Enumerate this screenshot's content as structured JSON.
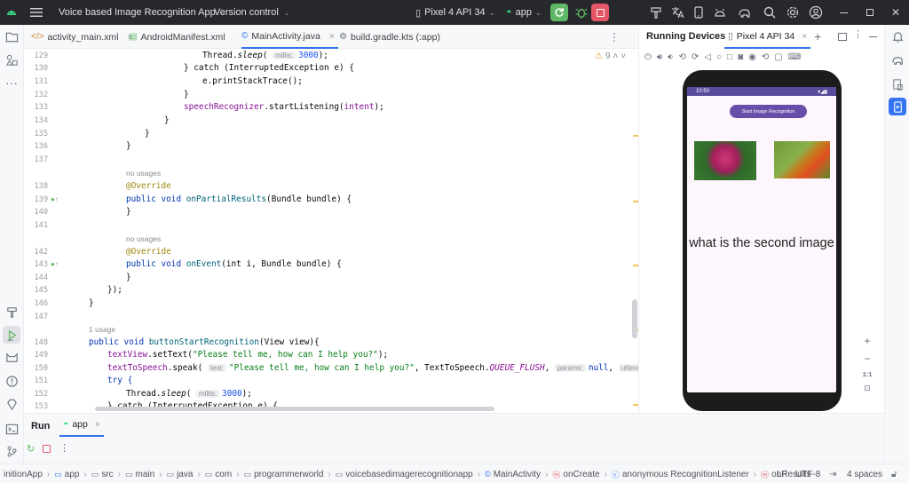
{
  "titlebar": {
    "project": "Voice based Image Recognition App",
    "vcs": "Version control",
    "device": "Pixel 4 API 34",
    "run_config": "app"
  },
  "tabs": [
    {
      "label": "activity_main.xml",
      "icon": "</>"
    },
    {
      "label": "AndroidManifest.xml",
      "icon": "▤"
    },
    {
      "label": "MainActivity.java",
      "icon": "©"
    },
    {
      "label": "build.gradle.kts (:app)",
      "icon": "⚙"
    }
  ],
  "editor": {
    "warnings": "9",
    "lines": [
      "129",
      "130",
      "131",
      "132",
      "133",
      "134",
      "135",
      "136",
      "137",
      "138",
      "139",
      "140",
      "141",
      "142",
      "143",
      "144",
      "145",
      "146",
      "147",
      "148",
      "149",
      "150",
      "151",
      "152",
      "153"
    ],
    "usages": [
      "no usages",
      "no usages",
      "1 usage"
    ],
    "hints": {
      "millis": "millis:",
      "text": "text:",
      "params": "params:",
      "utterance": "utteranceId:"
    },
    "code": {
      "l129a": "Thread.",
      "l129b": "sleep",
      "l129c": "( ",
      "l129d": "3000",
      "l129e": ");",
      "l130": "} catch (InterruptedException e) {",
      "l131": "e.printStackTrace();",
      "l132": "}",
      "l133a": "speechRecognizer",
      "l133b": ".startListening(",
      "l133c": "intent",
      "l133d": ");",
      "l134": "}",
      "l135": "}",
      "l136": "}",
      "l138": "@Override",
      "l139a": "public void ",
      "l139b": "onPartialResults",
      "l139c": "(Bundle bundle) {",
      "l140": "}",
      "l142": "@Override",
      "l143a": "public void ",
      "l143b": "onEvent",
      "l143c": "(int i, Bundle bundle) {",
      "l144": "}",
      "l145": "});",
      "l146": "}",
      "l148a": "public void ",
      "l148b": "buttonStartRecognition",
      "l148c": "(View view){",
      "l149a": "textView",
      "l149b": ".setText(",
      "l149c": "\"Please tell me, how can I help you?\"",
      "l149d": ");",
      "l150a": "textToSpeech",
      "l150b": ".speak( ",
      "l150c": "\"Please tell me, how can I help you?\"",
      "l150d": ", TextToSpeech.",
      "l150e": "QUEUE_FLUSH",
      "l150f": ",",
      "l150g": "null",
      "l150h": ",",
      "l151": "try {",
      "l152a": "Thread.",
      "l152b": "sleep",
      "l152c": "( ",
      "l152d": "3000",
      "l152e": ");",
      "l153": "} catch (InterruptedException e) {"
    }
  },
  "running_devices": {
    "title": "Running Devices",
    "device_tab": "Pixel 4 API 34",
    "phone": {
      "time": "10:50",
      "button_label": "Start Image Recognition",
      "text": "what is the second image"
    },
    "zoom_label": "1:1"
  },
  "run_panel": {
    "tab": "Run",
    "config": "app"
  },
  "statusbar": {
    "crumbs": [
      "initionApp",
      "app",
      "src",
      "main",
      "java",
      "com",
      "programmerworld",
      "voicebasedimagerecognitionapp",
      "MainActivity",
      "onCreate",
      "anonymous RecognitionListener",
      "onResults"
    ],
    "line_ending": "LF",
    "encoding": "UTF-8",
    "indent": "4 spaces"
  },
  "colors": {
    "accent": "#3574f0",
    "titlebar_bg": "#27282c",
    "run_green": "#5fb865",
    "stop_red": "#e55765"
  }
}
